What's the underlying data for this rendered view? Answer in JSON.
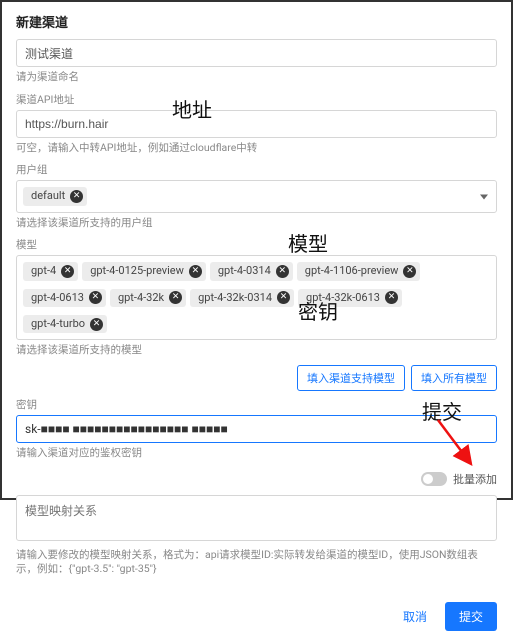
{
  "header": {
    "title": "新建渠道"
  },
  "name": {
    "value": "测试渠道",
    "helper": "请为渠道命名"
  },
  "api": {
    "label": "渠道API地址",
    "value": "https://burn.hair",
    "helper": "可空，请输入中转API地址，例如通过cloudflare中转"
  },
  "usergroup": {
    "label": "用户组",
    "tags": [
      "default"
    ],
    "helper": "请选择该渠道所支持的用户组"
  },
  "models": {
    "label": "模型",
    "tags": [
      "gpt-4",
      "gpt-4-0125-preview",
      "gpt-4-0314",
      "gpt-4-1106-preview",
      "gpt-4-0613",
      "gpt-4-32k",
      "gpt-4-32k-0314",
      "gpt-4-32k-0613",
      "gpt-4-turbo"
    ],
    "helper": "请选择该渠道所支持的模型",
    "btn_supported": "填入渠道支持模型",
    "btn_all": "填入所有模型"
  },
  "secret": {
    "label": "密钥",
    "value": "sk-■■■■ ■■■■■■■■■■■■■■■■ ■■■■■",
    "helper": "请输入渠道对应的鉴权密钥"
  },
  "batch": {
    "label": "批量添加"
  },
  "mapping": {
    "placeholder": "模型映射关系",
    "helper": "请输入要修改的模型映射关系，格式为：api请求模型ID:实际转发给渠道的模型ID，使用JSON数组表示，例如：{\"gpt-3.5\": \"gpt-35\"}"
  },
  "footer": {
    "cancel": "取消",
    "submit": "提交"
  },
  "annotations": {
    "addr": "地址",
    "model": "模型",
    "secret": "密钥",
    "submit": "提交"
  }
}
